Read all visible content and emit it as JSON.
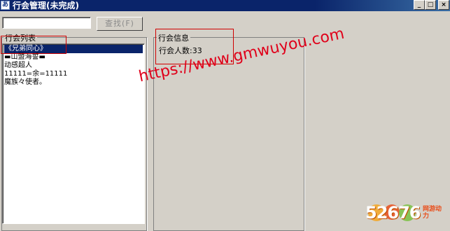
{
  "window": {
    "title": "行会管理(未完成)",
    "app_icon_glyph": "あ",
    "controls": {
      "minimize": "_",
      "maximize": "□",
      "close": "×"
    }
  },
  "search": {
    "value": "",
    "button_label": "查找(F)"
  },
  "guild_list": {
    "label": "行会列表",
    "items": [
      {
        "label": "《兄弟同心》",
        "selected": true
      },
      {
        "label": "▬山盟海誓▬",
        "selected": false
      },
      {
        "label": "动感超人",
        "selected": false
      },
      {
        "label": "11111=余=11111",
        "selected": false
      },
      {
        "label": "魔族々使者。",
        "selected": false
      }
    ]
  },
  "guild_info": {
    "label": "行会信息",
    "member_count_text": "行会人数:33"
  },
  "watermark": {
    "text": "https://www.gmwuyou.com",
    "color": "#e0001a"
  },
  "logo": {
    "text": "52676",
    "subtext": "网游动力"
  },
  "colors": {
    "titlebar": "#0a246a",
    "selection": "#0a246a",
    "window_bg": "#d4d0c8",
    "annotation_red": "#d00000"
  }
}
